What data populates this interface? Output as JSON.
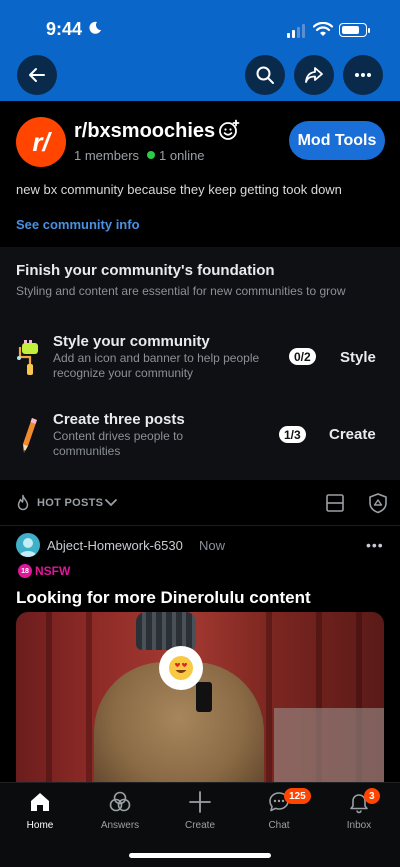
{
  "status": {
    "time": "9:44"
  },
  "header": {
    "back_icon": "arrow-left-icon",
    "search_icon": "search-icon",
    "share_icon": "share-arrow-icon",
    "more_icon": "more-horizontal-icon"
  },
  "community": {
    "avatar_text": "r/",
    "name": "r/bxsmoochies",
    "members": "1 members",
    "online": "1 online",
    "mod_button": "Mod Tools",
    "description": "new bx community because they keep getting took down",
    "info_link": "See community info"
  },
  "foundation": {
    "title": "Finish your community's foundation",
    "subtitle": "Styling and content are essential for new communities to grow",
    "tasks": [
      {
        "title": "Style your community",
        "subtitle": "Add an icon and banner to help people recognize your community",
        "progress": "0/2",
        "action": "Style"
      },
      {
        "title": "Create three posts",
        "subtitle": "Content drives people to communities",
        "progress": "1/3",
        "action": "Create"
      }
    ]
  },
  "sort": {
    "label": "HOT POSTS"
  },
  "post": {
    "user": "Abject-Homework-6530",
    "time": "Now",
    "nsfw_label": "NSFW",
    "nsfw_icon_text": "18",
    "title": "Looking for more Dinerolulu content"
  },
  "nav": {
    "items": [
      {
        "label": "Home",
        "icon": "home-icon"
      },
      {
        "label": "Answers",
        "icon": "answers-icon"
      },
      {
        "label": "Create",
        "icon": "plus-icon"
      },
      {
        "label": "Chat",
        "icon": "chat-icon",
        "badge": "125"
      },
      {
        "label": "Inbox",
        "icon": "bell-icon",
        "badge": "3"
      }
    ]
  },
  "colors": {
    "header_blue": "#0b66c9",
    "accent_orange": "#ff4500",
    "nsfw_pink": "#e0169b",
    "link_blue": "#4a90e2"
  }
}
